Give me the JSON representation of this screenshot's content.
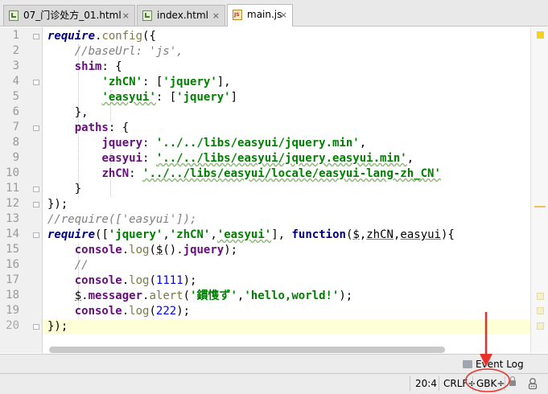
{
  "tabs": [
    {
      "label": "07_门诊处方_01.html",
      "icon": "html-file-icon",
      "close": "×",
      "active": false
    },
    {
      "label": "index.html",
      "icon": "html-file-icon",
      "close": "×",
      "active": false
    },
    {
      "label": "main.js",
      "icon": "js-file-icon",
      "close": "×",
      "active": true
    }
  ],
  "editor": {
    "line_numbers": [
      "1",
      "2",
      "3",
      "4",
      "5",
      "6",
      "7",
      "8",
      "9",
      "10",
      "11",
      "12",
      "13",
      "14",
      "15",
      "16",
      "17",
      "18",
      "19",
      "20"
    ],
    "current_line": 20,
    "lines": {
      "l1": [
        "require",
        ".",
        "config",
        "({"
      ],
      "l2": [
        "//baseUrl: 'js',"
      ],
      "l3": [
        "shim",
        ": {"
      ],
      "l4": [
        "'zhCN'",
        ": [",
        "'jquery'",
        "],"
      ],
      "l5": [
        "'easyui'",
        ": [",
        "'jquery'",
        "]"
      ],
      "l6": [
        "},"
      ],
      "l7": [
        "paths",
        ": {"
      ],
      "l8": [
        "jquery",
        ": ",
        "'../../libs/easyui/jquery.min'",
        ","
      ],
      "l9": [
        "easyui",
        ": ",
        "'../../libs/easyui/jquery.easyui.min'",
        ","
      ],
      "l10": [
        "zhCN",
        ": ",
        "'../../libs/easyui/locale/easyui-lang-zh_CN'"
      ],
      "l11": [
        "}"
      ],
      "l12": [
        "});"
      ],
      "l13": [
        "//require(['easyui']);"
      ],
      "l14": [
        "require",
        "([",
        "'jquery'",
        ",",
        "'zhCN'",
        ",",
        "'easyui'",
        "], ",
        "function",
        "(",
        "$",
        ",",
        "zhCN",
        ",",
        "easyui",
        "){"
      ],
      "l15": [
        "console",
        ".",
        "log",
        "(",
        "$",
        "().",
        "jquery",
        ");"
      ],
      "l16": [
        "//"
      ],
      "l17": [
        "console",
        ".",
        "log",
        "(",
        "1111",
        ");"
      ],
      "l18": [
        "$",
        ".",
        "messager",
        ".",
        "alert",
        "(",
        "'鏆愯ず'",
        ",",
        "'hello,world!'",
        ");"
      ],
      "l19": [
        "console",
        ".",
        "log",
        "(",
        "222",
        ");"
      ],
      "l20": [
        "});"
      ]
    }
  },
  "event_log": {
    "label": "Event Log",
    "icon": "event-log-icon"
  },
  "status": {
    "position": "20:4",
    "line_separator": "CRLF÷",
    "encoding": "GBK÷"
  },
  "colors": {
    "keyword": "#000080",
    "string": "#008000",
    "comment": "#808080",
    "number": "#0000ff",
    "property": "#660e7a",
    "current_line": "#ffffd7",
    "annotation_red": "#e8312a"
  }
}
